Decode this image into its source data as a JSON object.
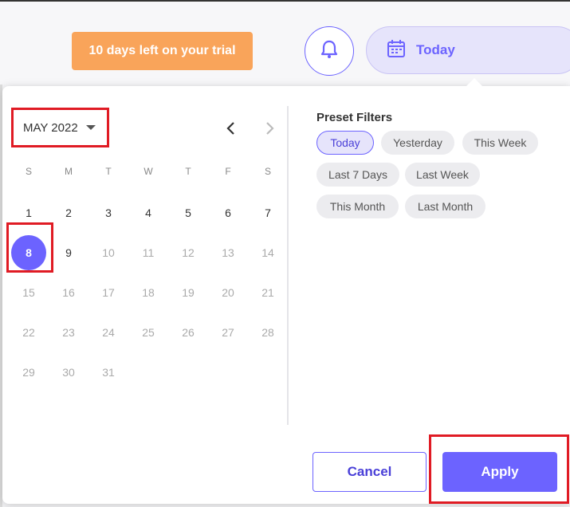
{
  "header": {
    "trial_banner": "10 days left on your trial",
    "date_range_label": "Today"
  },
  "calendar": {
    "month_label": "MAY 2022",
    "weekdays": [
      "S",
      "M",
      "T",
      "W",
      "T",
      "F",
      "S"
    ],
    "weeks": [
      [
        "1",
        "2",
        "3",
        "4",
        "5",
        "6",
        "7"
      ],
      [
        "8",
        "9",
        "10",
        "11",
        "12",
        "13",
        "14"
      ],
      [
        "15",
        "16",
        "17",
        "18",
        "19",
        "20",
        "21"
      ],
      [
        "22",
        "23",
        "24",
        "25",
        "26",
        "27",
        "28"
      ],
      [
        "29",
        "30",
        "31"
      ]
    ],
    "selected_day": "8",
    "enabled_days": [
      "1",
      "2",
      "3",
      "4",
      "5",
      "6",
      "7",
      "8",
      "9"
    ]
  },
  "presets": {
    "title": "Preset Filters",
    "chips": [
      "Today",
      "Yesterday",
      "This Week",
      "Last 7 Days",
      "Last Week",
      "This Month",
      "Last Month"
    ],
    "active": "Today"
  },
  "actions": {
    "cancel_label": "Cancel",
    "apply_label": "Apply"
  },
  "colors": {
    "accent": "#6c63ff",
    "trial_banner": "#f9a45a",
    "highlight_box": "#e01b24"
  },
  "icons": [
    "bell-icon",
    "calendar-icon",
    "caret-down-icon",
    "chevron-left-icon",
    "chevron-right-icon"
  ]
}
